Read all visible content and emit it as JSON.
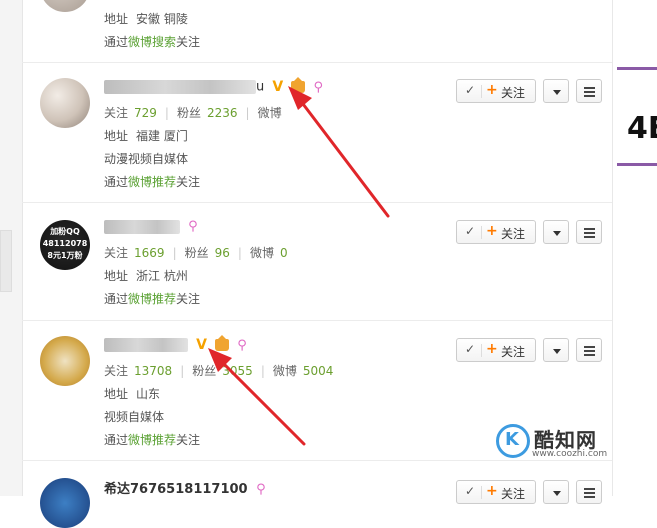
{
  "users": [
    {
      "name_visible": "",
      "location_label": "地址",
      "location": "安徽 铜陵",
      "via_prefix": "通过",
      "via_link": "微博搜索",
      "via_suffix": "关注"
    },
    {
      "name_visible": "u",
      "follows_label": "关注",
      "follows": "729",
      "fans_label": "粉丝",
      "fans": "2236",
      "weibo_label": "微博",
      "weibo": "",
      "location_label": "地址",
      "location": "福建 厦门",
      "bio": "动漫视频自媒体",
      "via_prefix": "通过",
      "via_link": "微博推荐",
      "via_suffix": "关注",
      "follow_button": "关注"
    },
    {
      "name_visible": "",
      "avatar_text": [
        "加粉QQ",
        "48112078",
        "8元1万粉"
      ],
      "follows_label": "关注",
      "follows": "1669",
      "fans_label": "粉丝",
      "fans": "96",
      "weibo_label": "微博",
      "weibo": "0",
      "location_label": "地址",
      "location": "浙江 杭州",
      "via_prefix": "通过",
      "via_link": "微博推荐",
      "via_suffix": "关注",
      "follow_button": "关注"
    },
    {
      "name_visible": "",
      "follows_label": "关注",
      "follows": "13708",
      "fans_label": "粉丝",
      "fans": "3055",
      "weibo_label": "微博",
      "weibo": "5004",
      "location_label": "地址",
      "location": "山东",
      "bio": "视频自媒体",
      "via_prefix": "通过",
      "via_link": "微博推荐",
      "via_suffix": "关注",
      "follow_button": "关注"
    },
    {
      "name_visible": "希达7676518117100",
      "follow_button": "关注"
    }
  ],
  "sidebar": {
    "big_text": "4E"
  },
  "watermark": {
    "brand": "酷知网",
    "url": "www.coozhi.com",
    "logo_letter": "K"
  },
  "colors": {
    "green_link": "#5aa133",
    "count_green": "#6b9f2f",
    "arrow_red": "#e0262a",
    "vip_orange": "#f5a100",
    "accent_purple": "#8a5aa6"
  }
}
